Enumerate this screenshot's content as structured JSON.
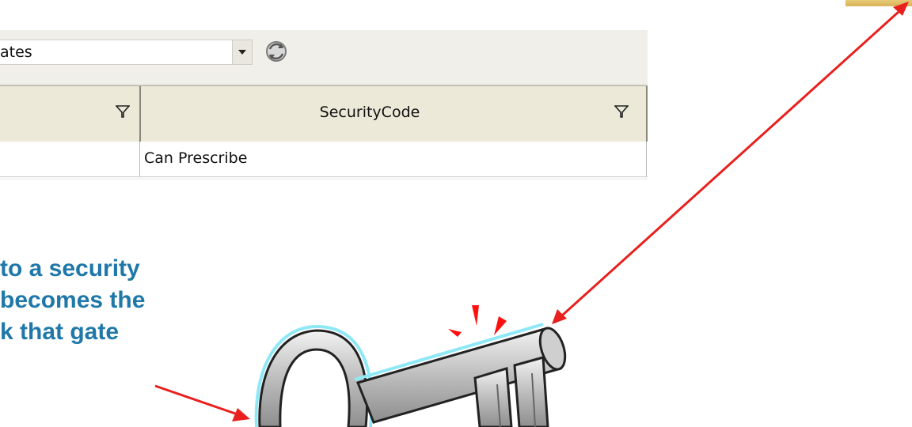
{
  "toolbar": {
    "combo_value": "ates",
    "dropdown_icon": "chevron-down-icon",
    "refresh_icon": "refresh-icon"
  },
  "grid": {
    "columns": [
      {
        "label": "",
        "filter_icon": "filter-icon"
      },
      {
        "label": "SecurityCode",
        "filter_icon": "filter-icon"
      }
    ],
    "rows": [
      {
        "cells": [
          "",
          "Can Prescribe"
        ]
      }
    ]
  },
  "callout": {
    "lines": [
      "to a security",
      "becomes the",
      "k that gate"
    ],
    "color": "#1f78a8"
  },
  "graphics": {
    "arrow_color": "#e8201e",
    "key_icon": "key-icon",
    "sparkle_color": "#ff1010"
  }
}
